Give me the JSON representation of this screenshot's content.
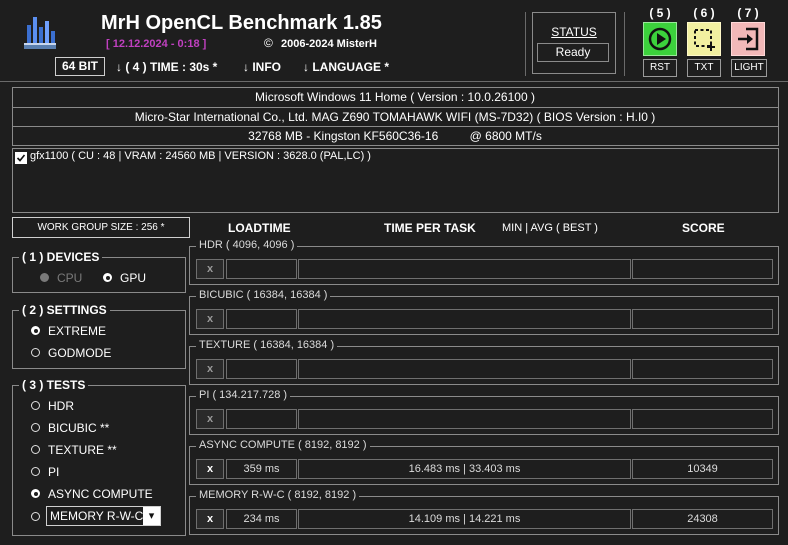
{
  "header": {
    "title": "MrH OpenCL Benchmark 1.85",
    "date": "[ 12.12.2024 - 0:18 ]",
    "copyright": "2006-2024 MisterH",
    "copyright_symbol": "©"
  },
  "menu": {
    "bits": "64 BIT",
    "time": "↓ ( 4 ) TIME : 30s *",
    "info": "↓ INFO",
    "language": "↓ LANGUAGE *"
  },
  "status": {
    "label": "STATUS",
    "value": "Ready"
  },
  "buttons": [
    {
      "num": "( 5 )",
      "label": "RST",
      "color": "#3cd13c"
    },
    {
      "num": "( 6 )",
      "label": "TXT",
      "color": "#f2f0a0"
    },
    {
      "num": "( 7 )",
      "label": "LIGHT",
      "color": "#f2b8b8"
    }
  ],
  "system": {
    "os": "Microsoft Windows 11 Home ( Version : 10.0.26100 )",
    "board": "Micro-Star International Co., Ltd. MAG Z690 TOMAHAWK WIFI (MS-7D32) ( BIOS Version : H.I0 )",
    "memory": "32768 MB - Kingston KF560C36-16",
    "memory_speed": "@ 6800 MT/s"
  },
  "device_list": {
    "item": "gfx1100 ( CU : 48 | VRAM : 24560 MB | VERSION : 3628.0 (PAL,LC) )",
    "checked": true
  },
  "work_group": "WORK GROUP SIZE : 256 *",
  "columns": {
    "loadtime": "LOADTIME",
    "time_per_task": "TIME PER TASK",
    "minavg": "MIN | AVG ( BEST )",
    "score": "SCORE"
  },
  "devices": {
    "title": "( 1 ) DEVICES",
    "cpu": "CPU",
    "gpu": "GPU"
  },
  "settings": {
    "title": "( 2 ) SETTINGS",
    "extreme": "EXTREME",
    "godmode": "GODMODE"
  },
  "tests": {
    "title": "( 3 ) TESTS",
    "items": [
      "HDR",
      "BICUBIC **",
      "TEXTURE **",
      "PI",
      "ASYNC COMPUTE"
    ],
    "dropdown": "MEMORY R-W-C",
    "dropdown_arrow": "▾"
  },
  "results": [
    {
      "name": "HDR ( 4096, 4096 )",
      "x": "x",
      "load": "",
      "time": "",
      "score": ""
    },
    {
      "name": "BICUBIC ( 16384, 16384 )",
      "x": "x",
      "load": "",
      "time": "",
      "score": ""
    },
    {
      "name": "TEXTURE ( 16384, 16384 )",
      "x": "x",
      "load": "",
      "time": "",
      "score": ""
    },
    {
      "name": "PI ( 134.217.728 )",
      "x": "x",
      "load": "",
      "time": "",
      "score": ""
    },
    {
      "name": "ASYNC COMPUTE ( 8192, 8192 )",
      "x": "x",
      "load": "359 ms",
      "time": "16.483 ms | 33.403 ms",
      "score": "10349"
    },
    {
      "name": "MEMORY R-W-C ( 8192, 8192 )",
      "x": "x",
      "load": "234 ms",
      "time": "14.109 ms | 14.221 ms",
      "score": "24308"
    }
  ]
}
